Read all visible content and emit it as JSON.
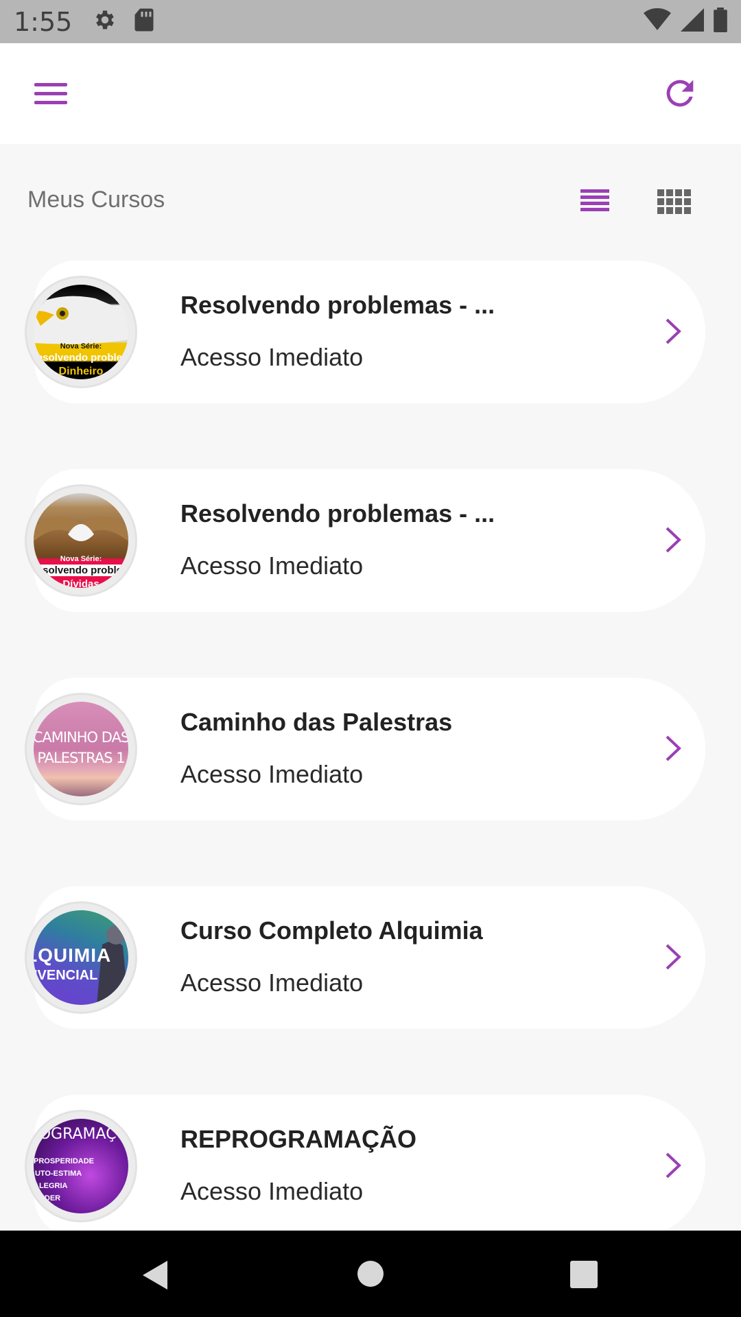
{
  "status_bar": {
    "time": "1:55",
    "icons": [
      "settings-icon",
      "sd-card-icon",
      "wifi-icon",
      "signal-icon",
      "battery-icon"
    ]
  },
  "app_bar": {
    "menu_icon": "hamburger-menu-icon",
    "refresh_icon": "refresh-icon",
    "accent_color": "#9b3fb5"
  },
  "section": {
    "title": "Meus Cursos",
    "view_list_icon": "list-view-icon",
    "view_grid_icon": "grid-view-icon"
  },
  "courses": [
    {
      "title": "Resolvendo problemas - ...",
      "status": "Acesso Imediato",
      "thumb_text": [
        "Nova Série:",
        "Resolvendo problemas",
        "Dinheiro"
      ]
    },
    {
      "title": "Resolvendo problemas - ...",
      "status": "Acesso Imediato",
      "thumb_text": [
        "Nova Série:",
        "Resolvendo problemas",
        "Dívidas"
      ]
    },
    {
      "title": "Caminho das Palestras",
      "status": "Acesso Imediato",
      "thumb_text": [
        "CAMINHO DAS",
        "PALESTRAS 1"
      ]
    },
    {
      "title": "Curso Completo Alquimia",
      "status": "Acesso Imediato",
      "thumb_text": [
        "ALQUIMIA",
        "VIVENCIAL"
      ]
    },
    {
      "title": "REPROGRAMAÇÃO",
      "status": "Acesso Imediato",
      "thumb_text": [
        "REPROGRAMAÇÕES",
        "PROSPERIDADE",
        "AUTO-ESTIMA",
        "ALEGRIA",
        "PODER"
      ]
    }
  ],
  "nav_bar": {
    "back_icon": "back-triangle-icon",
    "home_icon": "home-circle-icon",
    "recents_icon": "recents-square-icon"
  }
}
